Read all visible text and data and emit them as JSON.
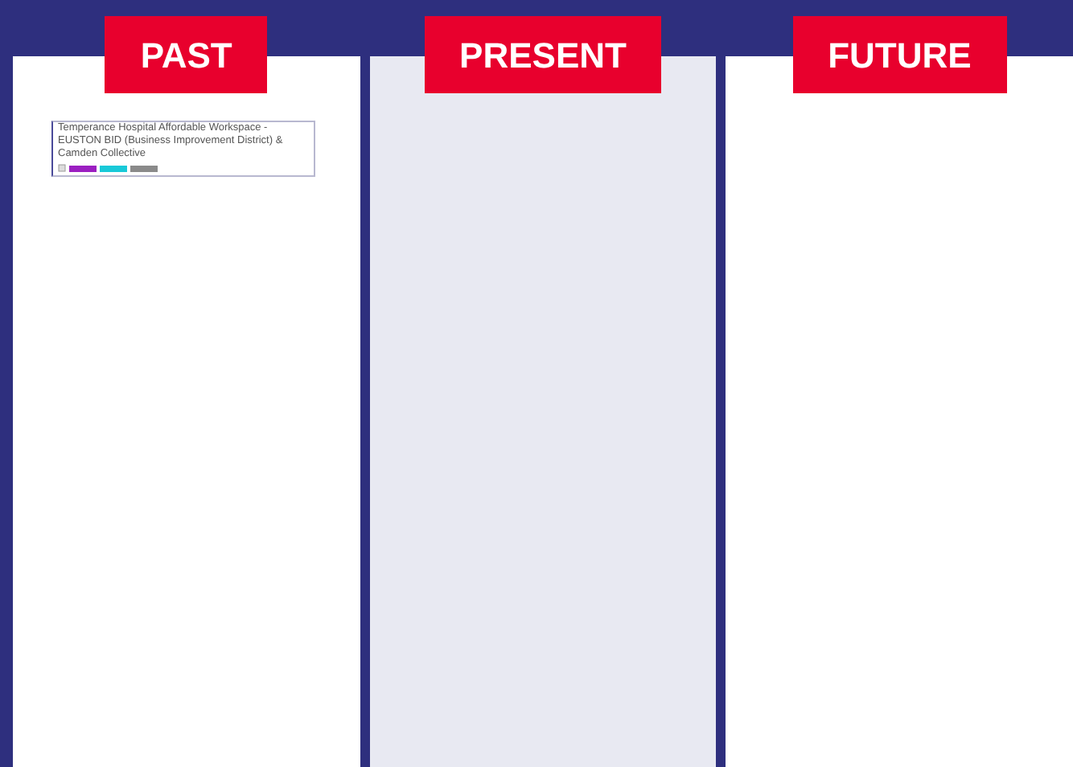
{
  "columns": [
    {
      "title": "PAST",
      "shaded": false,
      "cards": [
        {
          "text": "Temperance Hospital Affordable Workspace - EUSTON BID (Business Improvement District) & Camden Collective",
          "tags": [
            {
              "color": "#9b1fc1"
            },
            {
              "color": "#19c9d8"
            },
            {
              "color": "#8a8a8a"
            }
          ]
        }
      ]
    },
    {
      "title": "PRESENT",
      "shaded": true
    },
    {
      "title": "FUTURE",
      "shaded": false
    }
  ]
}
